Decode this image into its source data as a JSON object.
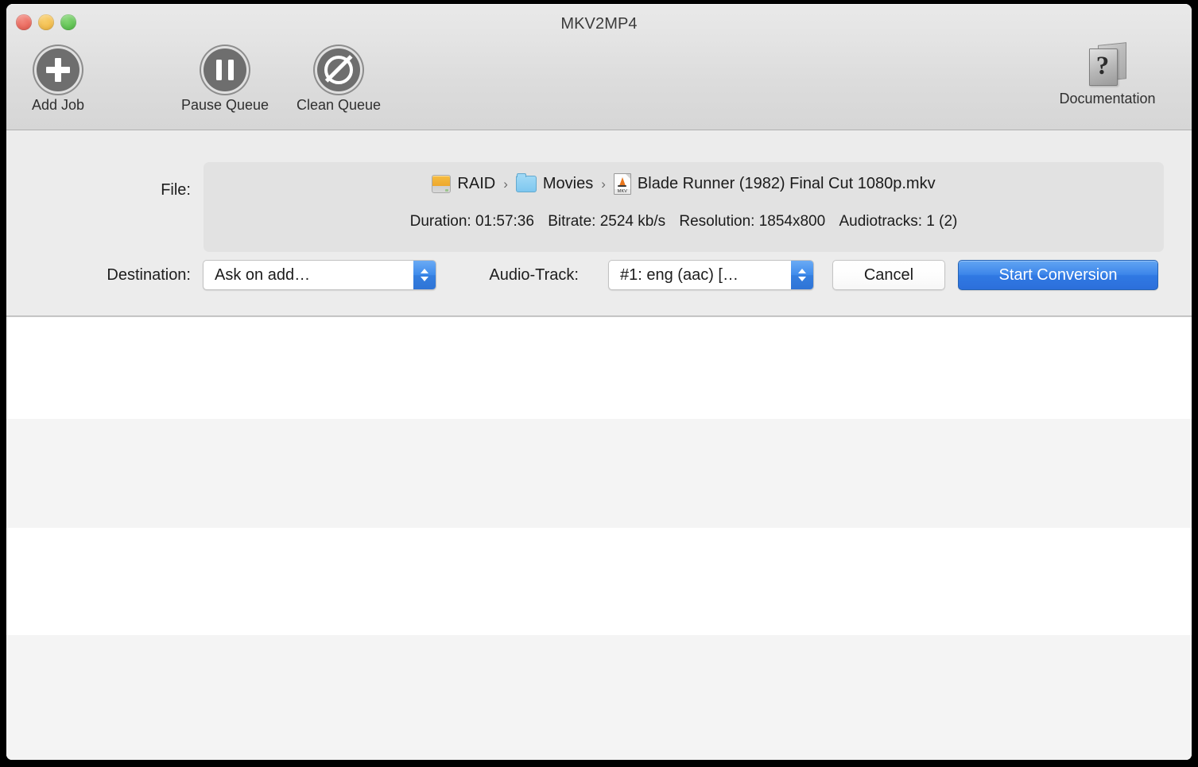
{
  "window": {
    "title": "MKV2MP4",
    "traffic_lights": {
      "close": "close-button",
      "minimize": "minimize-button",
      "maximize": "maximize-button"
    }
  },
  "toolbar": {
    "items": [
      {
        "label": "Add Job",
        "icon": "add-circle-icon"
      },
      {
        "label": "Pause Queue",
        "icon": "pause-circle-icon"
      },
      {
        "label": "Clean Queue",
        "icon": "prohibition-circle-icon"
      }
    ],
    "documentation": {
      "label": "Documentation",
      "icon": "question-book-icon"
    }
  },
  "info": {
    "file_label": "File:",
    "breadcrumb": [
      {
        "name": "RAID",
        "icon": "hard-drive-icon"
      },
      {
        "name": "Movies",
        "icon": "folder-icon"
      },
      {
        "name": "Blade Runner (1982) Final Cut 1080p.mkv",
        "icon": "mkv-file-icon"
      }
    ],
    "separator": "›",
    "metadata": {
      "duration": "Duration: 01:57:36",
      "bitrate": "Bitrate: 2524 kb/s",
      "resolution": "Resolution: 1854x800",
      "audiotracks": "Audiotracks: 1 (2)"
    }
  },
  "controls": {
    "destination_label": "Destination:",
    "destination_value": "Ask on add…",
    "audiotrack_label": "Audio-Track:",
    "audiotrack_value": "#1: eng (aac) […",
    "cancel_label": "Cancel",
    "start_label": "Start Conversion"
  },
  "job_table": {
    "rows": [
      "",
      "",
      "",
      ""
    ]
  },
  "colors": {
    "accent_blue": "#3d86ea",
    "toolbar_bg": "#e0e0e0",
    "panel_bg": "#ececec",
    "path_box_bg": "#e2e2e2",
    "row_alt_bg": "#f4f4f4",
    "traffic_close": "#ec6a5e",
    "traffic_min": "#f4bf4f",
    "traffic_max": "#61c454"
  }
}
